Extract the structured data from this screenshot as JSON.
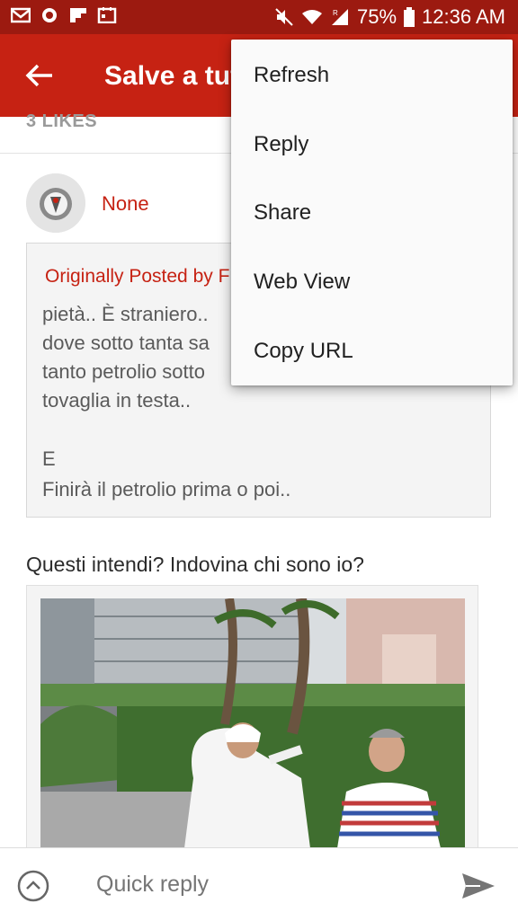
{
  "status_bar": {
    "battery_percent": "75%",
    "time": "12:36 AM",
    "left_icons": [
      "gmail-icon",
      "app-icon",
      "flipboard-icon",
      "calendar-icon"
    ],
    "right_icons": [
      "mute-icon",
      "wifi-icon",
      "signal-icon",
      "battery-icon"
    ]
  },
  "app_bar": {
    "title": "Salve a tutti"
  },
  "thread": {
    "likes": "3 LIKES",
    "post": {
      "username": "None",
      "quote": {
        "header": "Originally Posted by F",
        "lines": [
          "pietà.. È straniero..",
          "dove sotto tanta sa",
          "tanto petrolio sotto",
          "tovaglia in testa..",
          "",
          "E",
          "Finirà il petrolio prima o poi.."
        ]
      },
      "text": "Questi intendi? Indovina chi sono io?"
    }
  },
  "menu": {
    "items": [
      "Refresh",
      "Reply",
      "Share",
      "Web View",
      "Copy URL"
    ]
  },
  "bottom_bar": {
    "placeholder": "Quick reply"
  },
  "colors": {
    "status_bar": "#9c1a10",
    "app_bar": "#c62213",
    "accent": "#c62213"
  }
}
